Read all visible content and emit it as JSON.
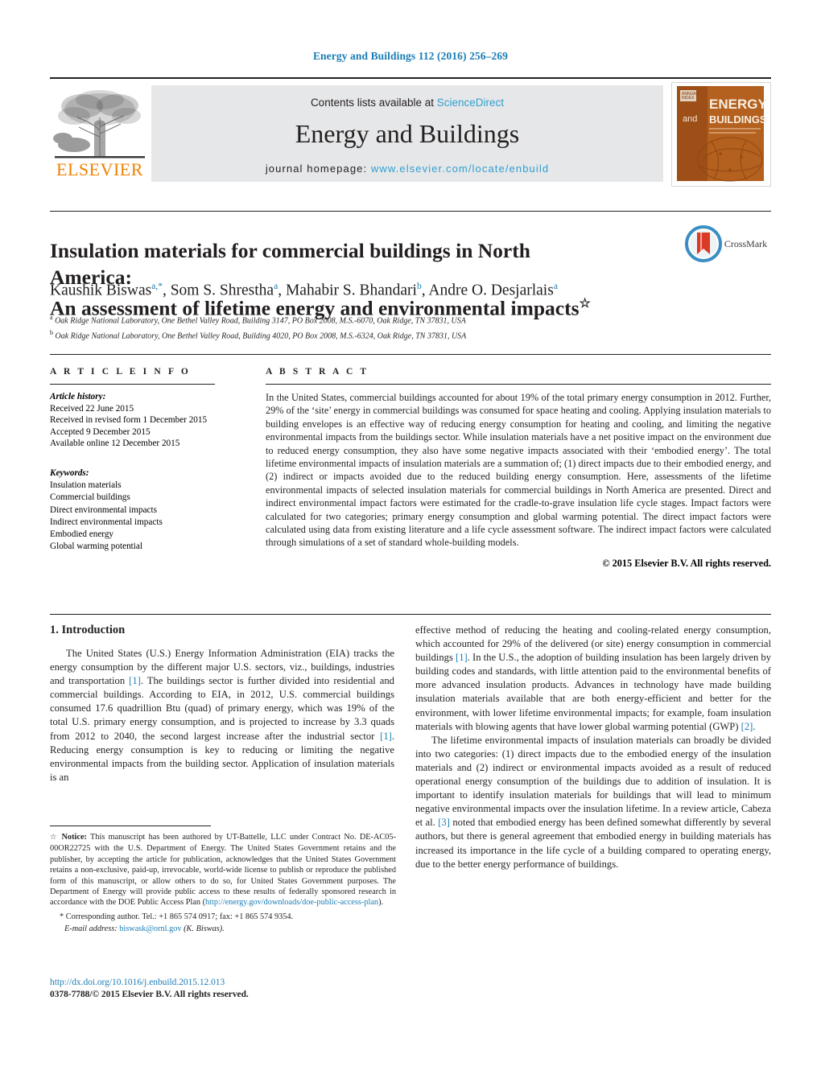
{
  "running_head": "Energy and Buildings 112 (2016) 256–269",
  "masthead": {
    "contents_prefix": "Contents lists available at ",
    "sciencedirect": "ScienceDirect",
    "journal_name": "Energy and Buildings",
    "homepage_prefix": "journal homepage: ",
    "homepage_url": "www.elsevier.com/locate/enbuild",
    "publisher_logo_text": "ELSEVIER",
    "cover_title_top": "ENERGY",
    "cover_title_and": "and",
    "cover_title_bottom": "BUILDINGS",
    "colors": {
      "link": "#2f9fd0",
      "elsevier_orange": "#ef8200",
      "band": "#e6e7e8",
      "cover": "#c0621f"
    }
  },
  "crossmark": {
    "label": "CrossMark",
    "ring_color": "#3b8ec2",
    "mark_color": "#d93a26"
  },
  "article": {
    "title_line1": "Insulation materials for commercial buildings in North America:",
    "title_line2": "An assessment of lifetime energy and environmental impacts",
    "title_footnote_marker": "☆",
    "authors": "Kaushik Biswas a,*, Som S. Shrestha a, Mahabir S. Bhandari b, Andre O. Desjarlais a",
    "affiliations": [
      "a Oak Ridge National Laboratory, One Bethel Valley Road, Building 3147, PO Box 2008, M.S.-6070, Oak Ridge, TN 37831, USA",
      "b Oak Ridge National Laboratory, One Bethel Valley Road, Building 4020, PO Box 2008, M.S.-6324, Oak Ridge, TN 37831, USA"
    ]
  },
  "article_info": {
    "heading": "A R T I C L E   I N F O",
    "history_title": "Article history:",
    "history": [
      "Received 22 June 2015",
      "Received in revised form 1 December 2015",
      "Accepted 9 December 2015",
      "Available online 12 December 2015"
    ],
    "keywords_title": "Keywords:",
    "keywords": [
      "Insulation materials",
      "Commercial buildings",
      "Direct environmental impacts",
      "Indirect environmental impacts",
      "Embodied energy",
      "Global warming potential"
    ]
  },
  "abstract": {
    "heading": "A B S T R A C T",
    "text": "In the United States, commercial buildings accounted for about 19% of the total primary energy consumption in 2012. Further, 29% of the ‘site’ energy in commercial buildings was consumed for space heating and cooling. Applying insulation materials to building envelopes is an effective way of reducing energy consumption for heating and cooling, and limiting the negative environmental impacts from the buildings sector. While insulation materials have a net positive impact on the environment due to reduced energy consumption, they also have some negative impacts associated with their ‘embodied energy’. The total lifetime environmental impacts of insulation materials are a summation of; (1) direct impacts due to their embodied energy, and (2) indirect or impacts avoided due to the reduced building energy consumption. Here, assessments of the lifetime environmental impacts of selected insulation materials for commercial buildings in North America are presented. Direct and indirect environmental impact factors were estimated for the cradle-to-grave insulation life cycle stages. Impact factors were calculated for two categories; primary energy consumption and global warming potential. The direct impact factors were calculated using data from existing literature and a life cycle assessment software. The indirect impact factors were calculated through simulations of a set of standard whole-building models.",
    "copyright": "© 2015 Elsevier B.V. All rights reserved."
  },
  "introduction": {
    "heading": "1.  Introduction",
    "left_para1_a": "The United States (U.S.) Energy Information Administration (EIA) tracks the energy consumption by the different major U.S. sectors, viz., buildings, industries and transportation ",
    "left_para1_ref1": "[1]",
    "left_para1_b": ". The buildings sector is further divided into residential and commercial buildings. According to EIA, in 2012, U.S. commercial buildings consumed 17.6 quadrillion Btu (quad) of primary energy, which was 19% of the total U.S. primary energy consumption, and is projected to increase by 3.3 quads from 2012 to 2040, the second largest increase after the industrial sector ",
    "left_para1_ref2": "[1]",
    "left_para1_c": ". Reducing energy consumption is key to reducing or limiting the negative environmental impacts from the building sector. Application of insulation materials is an",
    "right_para1_a": "effective method of reducing the heating and cooling-related energy consumption, which accounted for 29% of the delivered (or site) energy consumption in commercial buildings ",
    "right_para1_ref1": "[1]",
    "right_para1_b": ". In the U.S., the adoption of building insulation has been largely driven by building codes and standards, with little attention paid to the environmental benefits of more advanced insulation products. Advances in technology have made building insulation materials available that are both energy-efficient and better for the environment, with lower lifetime environmental impacts; for example, foam insulation materials with blowing agents that have lower global warming potential (GWP) ",
    "right_para1_ref2": "[2]",
    "right_para1_c": ".",
    "right_para2_a": "The lifetime environmental impacts of insulation materials can broadly be divided into two categories: (1) direct impacts due to the embodied energy of the insulation materials and (2) indirect or environmental impacts avoided as a result of reduced operational energy consumption of the buildings due to addition of insulation. It is important to identify insulation materials for buildings that will lead to minimum negative environmental impacts over the insulation lifetime. In a review article, Cabeza et al. ",
    "right_para2_ref1": "[3]",
    "right_para2_b": " noted that embodied energy has been defined somewhat differently by several authors, but there is general agreement that embodied energy in building materials has increased its importance in the life cycle of a building compared to operating energy, due to the better energy performance of buildings."
  },
  "footnotes": {
    "notice_marker": "☆",
    "notice_label": "Notice:",
    "notice_text_a": " This manuscript has been authored by UT-Battelle, LLC under Contract No. DE-AC05-00OR22725 with the U.S. Department of Energy. The United States Government retains and the publisher, by accepting the article for publication, acknowledges that the United States Government retains a non-exclusive, paid-up, irrevocable, world-wide license to publish or reproduce the published form of this manuscript, or allow others to do so, for United States Government purposes. The Department of Energy will provide public access to these results of federally sponsored research in accordance with the DOE Public Access Plan (",
    "notice_link": "http://energy.gov/downloads/doe-public-access-plan",
    "notice_text_b": ").",
    "corresponding_marker": "*",
    "corresponding": " Corresponding author. Tel.: +1 865 574 0917; fax: +1 865 574 9354.",
    "email_label": "E-mail address:",
    "email": "biswask@ornl.gov",
    "email_owner": "(K. Biswas)."
  },
  "footer": {
    "doi": "http://dx.doi.org/10.1016/j.enbuild.2015.12.013",
    "issn_line": "0378-7788/© 2015 Elsevier B.V. All rights reserved."
  }
}
